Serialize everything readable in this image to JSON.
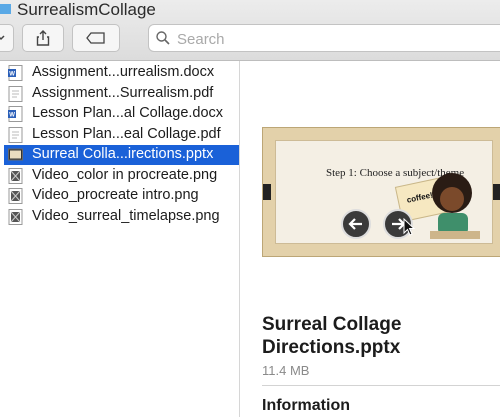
{
  "window": {
    "title": "SurrealismCollage"
  },
  "search": {
    "placeholder": "Search"
  },
  "files": [
    {
      "name": "Assignment...urrealism.docx",
      "type": "word"
    },
    {
      "name": "Assignment...Surrealism.pdf",
      "type": "pdf"
    },
    {
      "name": "Lesson Plan...al Collage.docx",
      "type": "word"
    },
    {
      "name": "Lesson Plan...eal Collage.pdf",
      "type": "pdf"
    },
    {
      "name": "Surreal Colla...irections.pptx",
      "type": "pptx",
      "selected": true
    },
    {
      "name": "Video_color in procreate.png",
      "type": "image"
    },
    {
      "name": "Video_procreate intro.png",
      "type": "image"
    },
    {
      "name": "Video_surreal_timelapse.png",
      "type": "image"
    }
  ],
  "preview": {
    "slide_text": "Step 1: Choose a subject/theme",
    "note_text": "coffee!",
    "file_title": "Surreal Collage Directions.pptx",
    "file_size": "11.4 MB",
    "info_heading": "Information"
  },
  "colors": {
    "selection": "#1a61d8"
  }
}
